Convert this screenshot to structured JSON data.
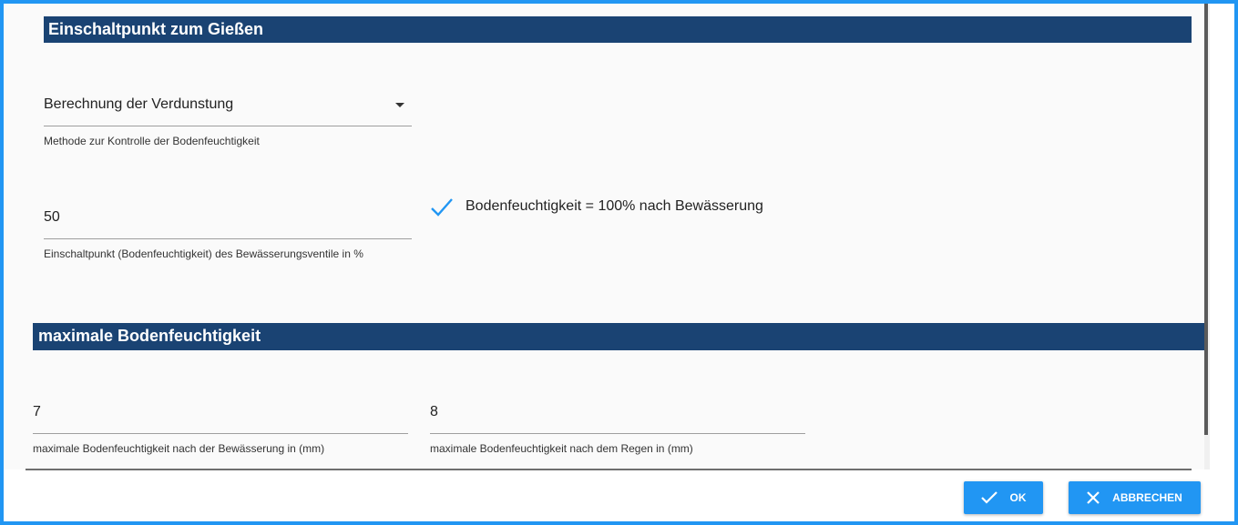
{
  "section1": {
    "title": "Einschaltpunkt zum Gießen",
    "method_select": {
      "value": "Berechnung der Verdunstung",
      "help": "Methode zur Kontrolle der Bodenfeuchtigkeit"
    },
    "threshold_field": {
      "value": "50",
      "help": "Einschaltpunkt (Bodenfeuchtigkeit) des Bewässerungsventile in %"
    },
    "checkbox": {
      "label": "Bodenfeuchtigkeit = 100% nach Bewässerung",
      "checked": true,
      "icon": "check-icon"
    }
  },
  "section2": {
    "title": "maximale Bodenfeuchtigkeit",
    "after_irrigation": {
      "value": "7",
      "help": "maximale Bodenfeuchtigkeit nach der Bewässerung in (mm)"
    },
    "after_rain": {
      "value": "8",
      "help": "maximale Bodenfeuchtigkeit nach dem Regen in (mm)"
    }
  },
  "footer": {
    "ok_label": "OK",
    "cancel_label": "ABBRECHEN"
  },
  "colors": {
    "accent": "#2196f3",
    "section_header": "#1a4373"
  }
}
